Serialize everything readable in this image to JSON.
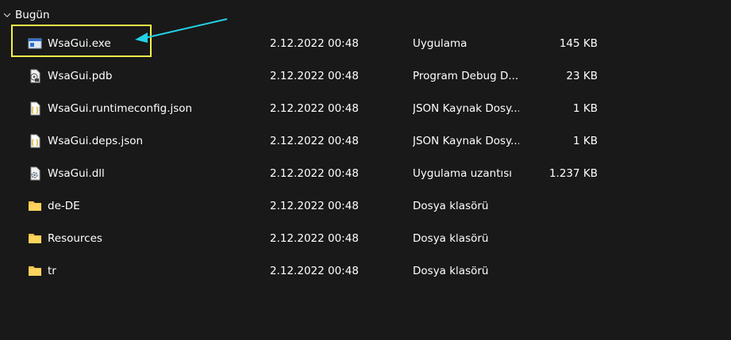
{
  "group": {
    "title": "Bugün",
    "icon": "chevron-down-icon"
  },
  "files": [
    {
      "name": "WsaGui.exe",
      "date": "2.12.2022 00:48",
      "type": "Uygulama",
      "size": "145 KB",
      "icon": "exe-icon"
    },
    {
      "name": "WsaGui.pdb",
      "date": "2.12.2022 00:48",
      "type": "Program Debug D...",
      "size": "23 KB",
      "icon": "pdb-file-icon"
    },
    {
      "name": "WsaGui.runtimeconfig.json",
      "date": "2.12.2022 00:48",
      "type": "JSON Kaynak Dosy...",
      "size": "1 KB",
      "icon": "json-file-icon"
    },
    {
      "name": "WsaGui.deps.json",
      "date": "2.12.2022 00:48",
      "type": "JSON Kaynak Dosy...",
      "size": "1 KB",
      "icon": "json-file-icon"
    },
    {
      "name": "WsaGui.dll",
      "date": "2.12.2022 00:48",
      "type": "Uygulama uzantısı",
      "size": "1.237 KB",
      "icon": "dll-file-icon"
    },
    {
      "name": "de-DE",
      "date": "2.12.2022 00:48",
      "type": "Dosya klasörü",
      "size": "",
      "icon": "folder-icon"
    },
    {
      "name": "Resources",
      "date": "2.12.2022 00:48",
      "type": "Dosya klasörü",
      "size": "",
      "icon": "folder-icon"
    },
    {
      "name": "tr",
      "date": "2.12.2022 00:48",
      "type": "Dosya klasörü",
      "size": "",
      "icon": "folder-icon"
    }
  ],
  "colors": {
    "background": "#191919",
    "text": "#ffffff",
    "highlight": "#f5f24a",
    "arrow": "#22d3e6",
    "folder": "#f4c24d"
  }
}
